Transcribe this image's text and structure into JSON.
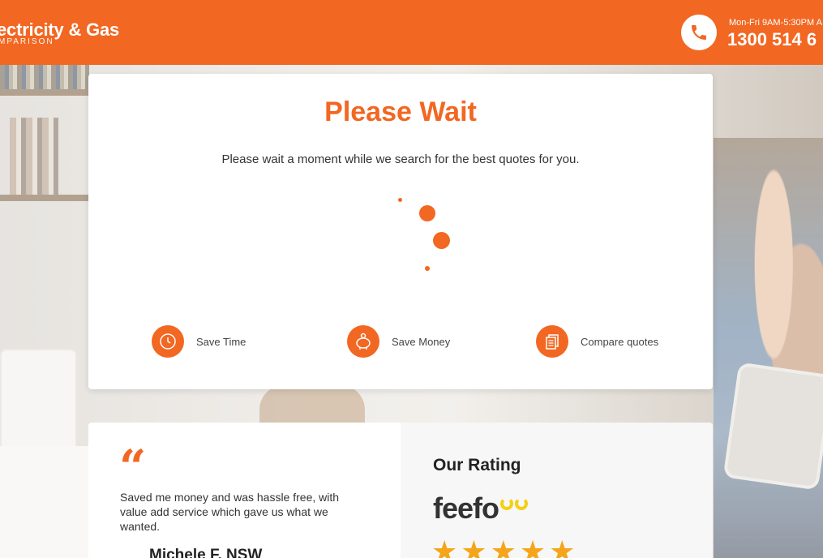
{
  "header": {
    "logo_main": "ectricity & Gas",
    "logo_sub": "MPARISON",
    "phone_hours": "Mon-Fri 9AM-5:30PM A",
    "phone_number": "1300 514 6"
  },
  "loader": {
    "title": "Please Wait",
    "message": "Please wait a moment while we search for the best quotes for you."
  },
  "features": [
    {
      "label": "Save Time",
      "icon": "clock-icon"
    },
    {
      "label": "Save Money",
      "icon": "piggy-bank-icon"
    },
    {
      "label": "Compare quotes",
      "icon": "documents-icon"
    }
  ],
  "review": {
    "quote_mark": "“",
    "text": "Saved me money and was hassle free, with value add service which gave us what we wanted.",
    "reviewer": "Michele F, NSW"
  },
  "rating": {
    "title": "Our Rating",
    "brand": "feefo",
    "stars": 5
  },
  "colors": {
    "brand_orange": "#f26722",
    "star_gold": "#f5a51a",
    "feefo_yellow": "#f5cf12"
  }
}
